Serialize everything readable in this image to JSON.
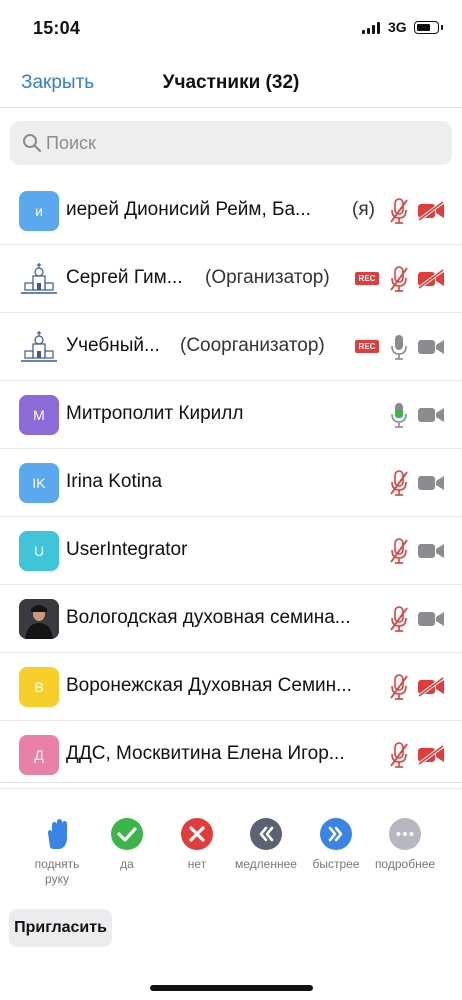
{
  "status_bar": {
    "time": "15:04",
    "network": "3G",
    "battery_level": 0.75
  },
  "nav": {
    "close_label": "Закрыть",
    "title": "Участники (32)"
  },
  "search": {
    "placeholder": "Поиск",
    "value": ""
  },
  "participants": [
    {
      "initials": "и",
      "avatar_color": "#5aa9ef",
      "name": "иерей Дионисий Рейм, Ба...",
      "role": "(я)",
      "recording": false,
      "mic": "muted",
      "camera": "off"
    },
    {
      "initials": "",
      "avatar_color": "",
      "name": "Сергей Гим...",
      "role": "(Организатор)",
      "recording": true,
      "mic": "muted",
      "camera": "off"
    },
    {
      "initials": "",
      "avatar_color": "",
      "name": "Учебный...",
      "role": "(Соорганизатор)",
      "recording": true,
      "mic": "on-gray",
      "camera": "on"
    },
    {
      "initials": "М",
      "avatar_color": "#8c6ad8",
      "name": "Митрополит Кирилл",
      "role": "",
      "recording": false,
      "mic": "speaking",
      "camera": "on"
    },
    {
      "initials": "IK",
      "avatar_color": "#5aa9ef",
      "name": "Irina Kotina",
      "role": "",
      "recording": false,
      "mic": "muted",
      "camera": "on"
    },
    {
      "initials": "U",
      "avatar_color": "#3fc4d8",
      "name": "UserIntegrator",
      "role": "",
      "recording": false,
      "mic": "muted",
      "camera": "on"
    },
    {
      "initials": "",
      "avatar_color": "",
      "name": "Вологодская духовная семина...",
      "role": "",
      "recording": false,
      "mic": "muted",
      "camera": "on"
    },
    {
      "initials": "В",
      "avatar_color": "#f7cf2a",
      "name": "Воронежская Духовная Семин...",
      "role": "",
      "recording": false,
      "mic": "muted",
      "camera": "off"
    },
    {
      "initials": "Д",
      "avatar_color": "#e880a8",
      "name": "ДДС, Москвитина Елена Игор...",
      "role": "",
      "recording": false,
      "mic": "muted",
      "camera": "off"
    }
  ],
  "rec_label": "REC",
  "actions": [
    {
      "icon": "raise-hand-icon",
      "label": "поднять руку",
      "color": "#3a84e6"
    },
    {
      "icon": "check-icon",
      "label": "да",
      "color": "#3bb54a"
    },
    {
      "icon": "close-icon",
      "label": "нет",
      "color": "#e23b3b"
    },
    {
      "icon": "rewind-icon",
      "label": "медленнее",
      "color": "#5b6271"
    },
    {
      "icon": "fast-forward-icon",
      "label": "быстрее",
      "color": "#3a84e6"
    },
    {
      "icon": "more-icon",
      "label": "подробнее",
      "color": "#b7b7c2"
    }
  ],
  "invite_label": "Пригласить"
}
